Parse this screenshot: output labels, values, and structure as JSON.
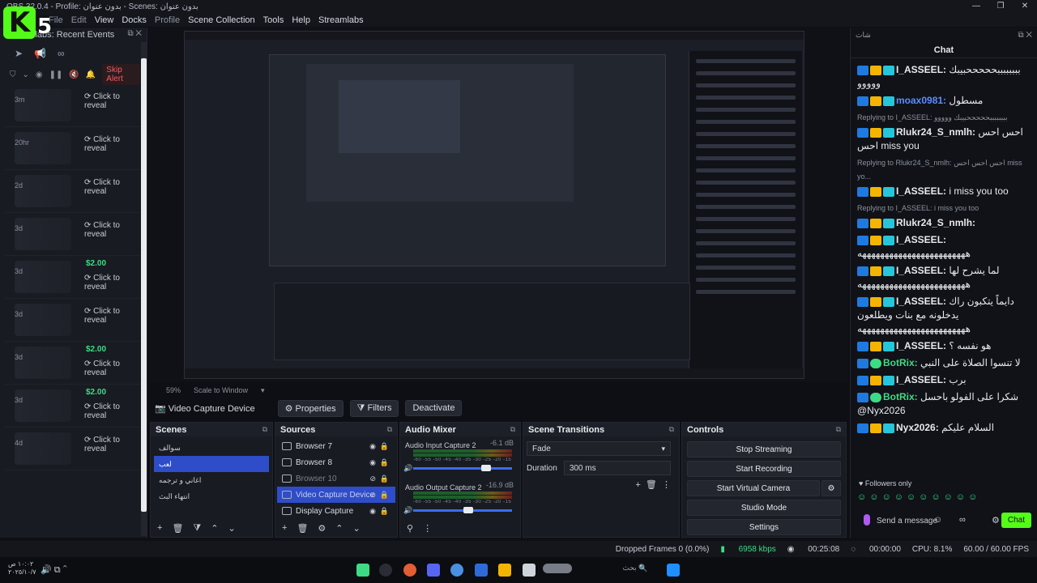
{
  "window": {
    "title": "OBS 32.0.4 - Profile: بدون عنوان - Scenes: بدون عنوان",
    "controls": [
      "—",
      "❐",
      "✕"
    ]
  },
  "logo": {
    "letter": "K",
    "number": "5"
  },
  "menu": [
    "File",
    "Edit",
    "View",
    "Docks",
    "Profile",
    "Scene Collection",
    "Tools",
    "Help",
    "Streamlabs"
  ],
  "left_dock": {
    "title": "Streamlabs: Recent Events",
    "skip_alert": "Skip Alert",
    "events": [
      {
        "age": "3m",
        "reveal": "Click to reveal",
        "amount": ""
      },
      {
        "age": "20hr",
        "reveal": "Click to reveal",
        "amount": ""
      },
      {
        "age": "2d",
        "reveal": "Click to reveal",
        "amount": ""
      },
      {
        "age": "3d",
        "reveal": "Click to reveal",
        "amount": ""
      },
      {
        "age": "3d",
        "reveal": "Click to reveal",
        "amount": "$2.00"
      },
      {
        "age": "3d",
        "reveal": "Click to reveal",
        "amount": ""
      },
      {
        "age": "3d",
        "reveal": "Click to reveal",
        "amount": "$2.00"
      },
      {
        "age": "3d",
        "reveal": "Click to reveal",
        "amount": "$2.00"
      },
      {
        "age": "4d",
        "reveal": "Click to reveal",
        "amount": ""
      }
    ]
  },
  "zoom": {
    "level": "59%",
    "mode": "Scale to Window"
  },
  "source_toolbar": {
    "source_name": "Video Capture Device",
    "properties": "Properties",
    "filters": "Filters",
    "deactivate": "Deactivate"
  },
  "scenes": {
    "title": "Scenes",
    "items": [
      "سوالف",
      "لعب",
      "اغاني و ترجمه",
      "انتهاء البث"
    ],
    "selected_index": 1
  },
  "sources": {
    "title": "Sources",
    "items": [
      {
        "name": "Browser 7",
        "visible": true
      },
      {
        "name": "Browser 8",
        "visible": true
      },
      {
        "name": "Browser 10",
        "visible": false
      },
      {
        "name": "Video Capture Device",
        "visible": false
      },
      {
        "name": "Display Capture",
        "visible": true
      }
    ],
    "selected_index": 3
  },
  "mixer": {
    "title": "Audio Mixer",
    "channels": [
      {
        "name": "Audio Input Capture 2",
        "db": "-6.1 dB",
        "level": 0.74
      },
      {
        "name": "Audio Output Capture 2",
        "db": "-16.9 dB",
        "level": 0.56
      }
    ],
    "ticks": "-60 -55 -50 -45 -40 -35 -30 -25 -20 -15 -10 -5 0"
  },
  "transitions": {
    "title": "Scene Transitions",
    "selected": "Fade",
    "duration_label": "Duration",
    "duration": "300 ms"
  },
  "controls": {
    "title": "Controls",
    "buttons": [
      "Stop Streaming",
      "Start Recording",
      "Start Virtual Camera",
      "Studio Mode",
      "Settings"
    ]
  },
  "status": {
    "dropped": "Dropped Frames 0 (0.0%)",
    "bitrate": "6958 kbps",
    "stream_time": "00:25:08",
    "rec_time": "00:00:00",
    "cpu": "CPU: 8.1%",
    "fps": "60.00 / 60.00 FPS"
  },
  "taskbar": {
    "time": "١٠:٠٢ ص",
    "date": "٢٠٢٥/١٠/٧",
    "search": "بحث"
  },
  "chat": {
    "dock_title": "شات",
    "title": "Chat",
    "messages": [
      {
        "user": "I_ASSEEL:",
        "text": "ببببببببحححححبيبك ووووو",
        "user_color": "#e6e9ee",
        "reply": ""
      },
      {
        "user": "moax0981:",
        "text": "مسطول",
        "user_color": "#5b8cff",
        "reply": ""
      },
      {
        "user": "Rlukr24_S_nmlh:",
        "text": "احس احس احس miss you",
        "user_color": "#e6e9ee",
        "reply": "Replying to I_ASSEEL: ببببببببحححححبيبك ووووو"
      },
      {
        "user": "I_ASSEEL:",
        "text": "i miss you too",
        "user_color": "#e6e9ee",
        "reply": "Replying to Rlukr24_S_nmlh: احس احس احس miss yo..."
      },
      {
        "user": "Rlukr24_S_nmlh:",
        "text": "",
        "user_color": "#e6e9ee",
        "reply": "Replying to I_ASSEEL: i miss you too"
      },
      {
        "user": "I_ASSEEL:",
        "text": "ههههههههههههههههههههههههه",
        "user_color": "#e6e9ee",
        "reply": ""
      },
      {
        "user": "I_ASSEEL:",
        "text": "لما يشرح لها ههههههههههههههههههههههههه",
        "user_color": "#e6e9ee",
        "reply": ""
      },
      {
        "user": "I_ASSEEL:",
        "text": "دايماً يتكبون راك يدخلونه مع بنات ويطلعون ههههههههههههههههههههههههه",
        "user_color": "#e6e9ee",
        "reply": ""
      },
      {
        "user": "I_ASSEEL:",
        "text": "هو نفسه ؟",
        "user_color": "#e6e9ee",
        "reply": ""
      },
      {
        "user": "BotRix:",
        "text": "لا تنسوا الصلاة على النبي",
        "user_color": "#3ddc84",
        "reply": ""
      },
      {
        "user": "I_ASSEEL:",
        "text": "برب",
        "user_color": "#e6e9ee",
        "reply": ""
      },
      {
        "user": "BotRix:",
        "text": "شكرا على الفولو باحسل @Nyx2026",
        "user_color": "#3ddc84",
        "reply": ""
      },
      {
        "user": "Nyx2026:",
        "text": "السلام عليكم",
        "user_color": "#e6e9ee",
        "reply": ""
      }
    ],
    "followers_only": "Followers only",
    "emotes": "☺☺☺☺☺☺☺☺☺☺",
    "send_placeholder": "Send a message",
    "chat_button": "Chat"
  },
  "colors": {
    "accent": "#2f4dc9",
    "kick_green": "#53fc18",
    "bot_green": "#3ddc84",
    "donation": "#3ddc84"
  }
}
